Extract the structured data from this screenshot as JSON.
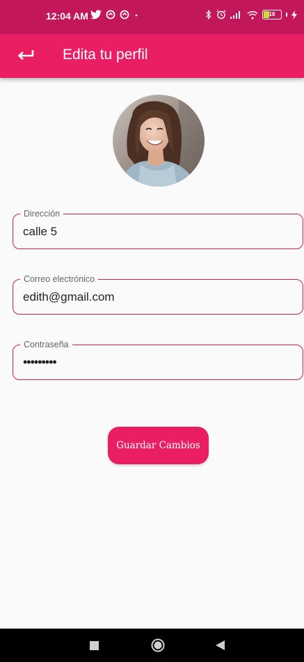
{
  "status_bar": {
    "time": "12:04 AM",
    "battery_level": "18",
    "accent_color": "#c2185b"
  },
  "app_bar": {
    "title": "Edita tu perfil",
    "back_icon": "back-arrow-icon",
    "color": "#e91e63"
  },
  "profile": {
    "avatar_icon": "profile-photo"
  },
  "form": {
    "address": {
      "label": "Dirección",
      "value": "calle 5"
    },
    "email": {
      "label": "Correo electrónico",
      "value": "edith@gmail.com"
    },
    "password": {
      "label": "Contraseña",
      "value": "•••••••••"
    }
  },
  "actions": {
    "save_label": "Guardar Cambios"
  },
  "nav_bar": {
    "icons": [
      "recents-square-icon",
      "home-circle-icon",
      "back-triangle-icon"
    ]
  }
}
